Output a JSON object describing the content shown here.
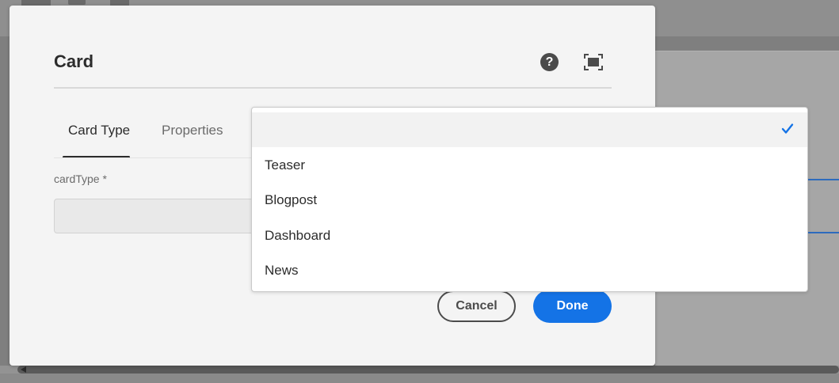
{
  "dialog": {
    "title": "Card",
    "tabs": [
      {
        "label": "Card Type",
        "active": true
      },
      {
        "label": "Properties",
        "active": false
      }
    ],
    "field": {
      "label": "cardType *",
      "value": ""
    },
    "buttons": {
      "cancel_label": "Cancel",
      "done_label": "Done"
    },
    "icons": [
      "help-icon",
      "fullscreen-icon"
    ]
  },
  "dropdown": {
    "options": [
      {
        "label": "",
        "selected": true
      },
      {
        "label": "Teaser",
        "selected": false
      },
      {
        "label": "Blogpost",
        "selected": false
      },
      {
        "label": "Dashboard",
        "selected": false
      },
      {
        "label": "News",
        "selected": false
      }
    ],
    "check_icon": "checkmark-icon"
  },
  "colors": {
    "accent": "#1473e6",
    "dialog_bg": "#f4f4f4",
    "overlay": "#939393"
  }
}
